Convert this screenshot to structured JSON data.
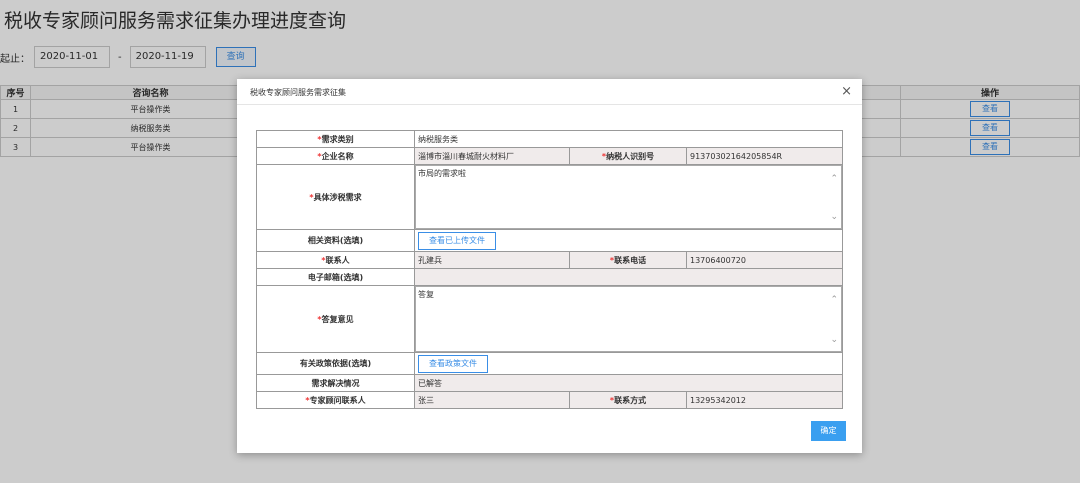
{
  "page": {
    "title": "税收专家顾问服务需求征集办理进度查询",
    "filter_label": "起止：",
    "date_from": "2020-11-01",
    "date_sep": "-",
    "date_to": "2020-11-19",
    "query_label": "查询"
  },
  "table": {
    "headers": [
      "序号",
      "咨询名称",
      "操作"
    ],
    "rows": [
      {
        "no": "1",
        "name": "平台操作类",
        "action": "查看"
      },
      {
        "no": "2",
        "name": "纳税服务类",
        "action": "查看"
      },
      {
        "no": "3",
        "name": "平台操作类",
        "action": "查看"
      }
    ]
  },
  "modal": {
    "title": "税收专家顾问服务需求征集",
    "close": "×",
    "ok": "确定",
    "required_mark": "*",
    "labels": {
      "category": "需求类别",
      "company": "企业名称",
      "taxpayer_id": "纳税人识别号",
      "detail": "具体涉税需求",
      "materials": "相关资料(选填)",
      "contact": "联系人",
      "phone": "联系电话",
      "email": "电子邮箱(选填)",
      "reply": "答复意见",
      "policy": "有关政策依据(选填)",
      "resolution": "需求解决情况",
      "expert": "专家顾问联系人",
      "expert_phone": "联系方式"
    },
    "values": {
      "category": "纳税服务类",
      "company": "淄博市淄川春城耐火材料厂",
      "taxpayer_id": "91370302164205854R",
      "detail": "市局的需求啦",
      "materials_btn": "查看已上传文件",
      "contact": "孔建兵",
      "phone": "13706400720",
      "email": "",
      "reply": "答复",
      "policy_btn": "查看政策文件",
      "resolution": "已解答",
      "expert": "张三",
      "expert_phone": "13295342012"
    }
  }
}
